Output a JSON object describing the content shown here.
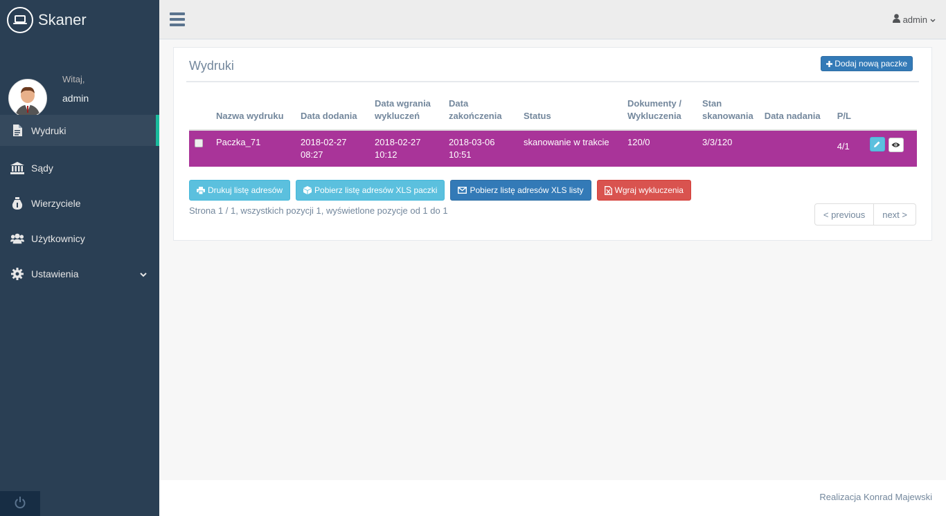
{
  "brand": {
    "title": "Skaner",
    "icon": "laptop-icon"
  },
  "profile": {
    "welcome": "Witaj,",
    "username": "admin"
  },
  "nav": {
    "items": [
      {
        "label": "Wydruki",
        "icon": "file-icon",
        "active": true
      },
      {
        "label": "Sądy",
        "icon": "bank-icon"
      },
      {
        "label": "Wierzyciele",
        "icon": "money-bag-icon"
      },
      {
        "label": "Użytkownicy",
        "icon": "users-icon"
      },
      {
        "label": "Ustawienia",
        "icon": "gear-icon",
        "has_submenu": true
      }
    ]
  },
  "topbar": {
    "user": "admin"
  },
  "panel": {
    "title": "Wydruki",
    "add_button": "Dodaj nową paczke",
    "columns": [
      "Nazwa wydruku",
      "Data dodania",
      "Data wgrania wykluczeń",
      "Data zakończenia",
      "Status",
      "Dokumenty / Wykluczenia",
      "Stan skanowania",
      "Data nadania",
      "P/L"
    ],
    "rows": [
      {
        "name": "Paczka_71",
        "date_added": "2018-02-27 08:27",
        "date_exclusions": "2018-02-27 10:12",
        "date_finished": "2018-03-06 10:51",
        "status": "skanowanie w trakcie",
        "documents": "120/0",
        "scan_state": "3/3/120",
        "date_sent": "",
        "pl": "4/1",
        "highlight_color": "#A93499"
      }
    ],
    "buttons": {
      "print": "Drukuj listę adresów",
      "xls_package": "Pobierz listę adresów XLS paczki",
      "xls_list": "Pobierz listę adresów XLS listy",
      "upload": "Wgraj wykluczenia"
    },
    "page_info": "Strona 1 / 1, wszystkich pozycji 1, wyświetlone pozycje od 1 do 1",
    "pager": {
      "prev": "< previous",
      "next": "next >"
    }
  },
  "footer": {
    "credit": "Realizacja Konrad Majewski"
  }
}
